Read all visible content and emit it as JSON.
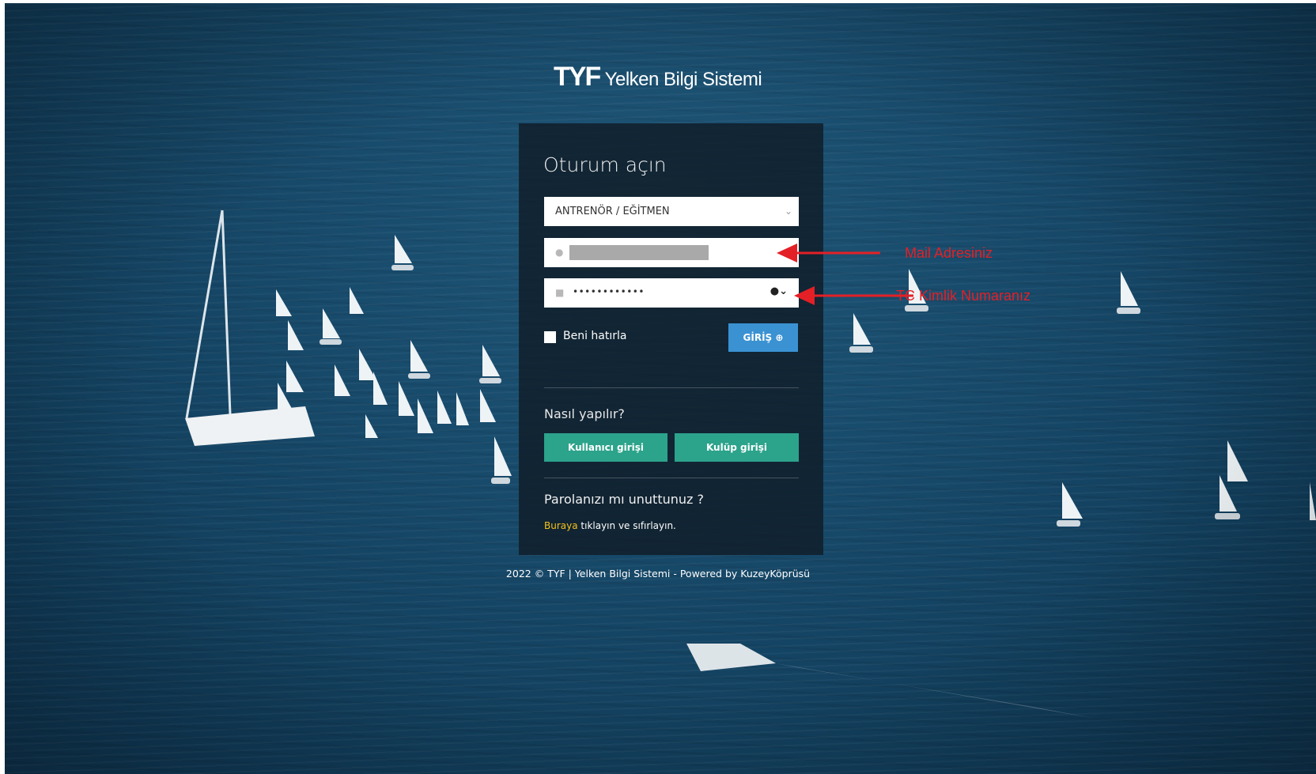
{
  "header": {
    "logo_mark": "TYF",
    "logo_text": "Yelken Bilgi Sistemi"
  },
  "login": {
    "title": "Oturum açın",
    "role_select": {
      "value": "ANTRENÖR / EĞİTMEN"
    },
    "username": {
      "value": ""
    },
    "password": {
      "value": "••••••••••••"
    },
    "remember_label": "Beni hatırla",
    "submit_label": "GİRİŞ",
    "howto_label": "Nasıl yapılır?",
    "user_login_label": "Kullanıcı girişi",
    "club_login_label": "Kulüp girişi",
    "forgot_label": "Parolanızı mı unuttunuz ?",
    "reset_link": "Buraya",
    "reset_text": " tıklayın ve sıfırlayın."
  },
  "footer": {
    "text": "2022 © TYF | Yelken Bilgi Sistemi - Powered by KuzeyKöprüsü"
  },
  "annotations": {
    "email": "Mail Adresiniz",
    "tc": "TC Kimlik Numaranız"
  },
  "colors": {
    "sea": "#184b6c",
    "panel": "#101e2a",
    "primary_button": "#3a92d2",
    "secondary_button": "#2ca38b",
    "link": "#f2c11a",
    "annotation": "#e32026"
  },
  "icons": [
    "user-icon",
    "lock-icon",
    "key-icon",
    "chevron-down-icon",
    "arrow-circle-right-icon"
  ]
}
